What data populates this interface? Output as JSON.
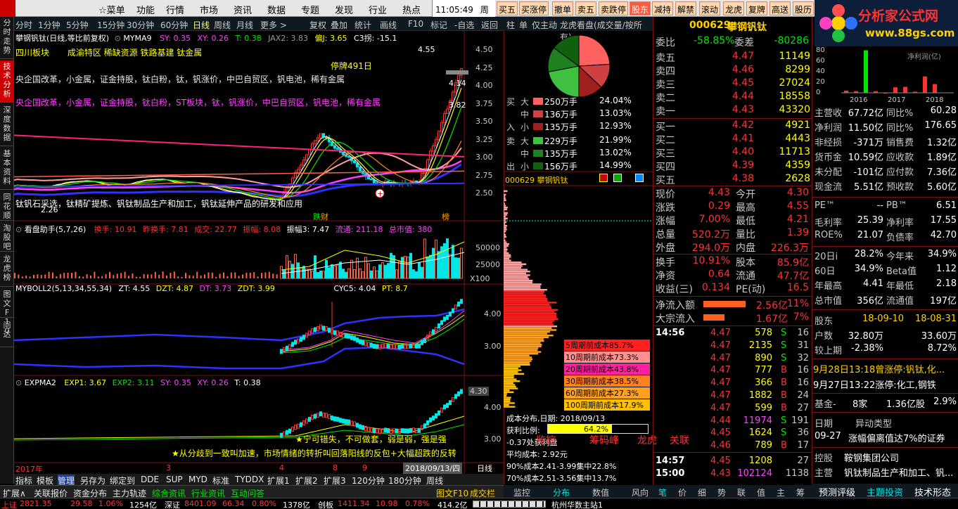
{
  "menu": {
    "items": [
      "☆菜单",
      "功能",
      "行情",
      "市场",
      "资讯",
      "数据",
      "专题",
      "发现",
      "行业",
      "热点"
    ],
    "time": "11:05:49",
    "weekday": "周五",
    "quick": [
      {
        "label": "买五",
        "red": false
      },
      {
        "label": "买涨停",
        "red": false
      },
      {
        "label": "撤单",
        "red": false
      },
      {
        "label": "卖五",
        "red": false
      },
      {
        "label": "卖跌停",
        "red": false
      },
      {
        "label": "股东",
        "red": true
      },
      {
        "label": "减持",
        "red": false
      },
      {
        "label": "解禁",
        "red": false
      },
      {
        "label": "滚动",
        "red": false
      },
      {
        "label": "龙虎",
        "red": false
      },
      {
        "label": "复牌",
        "red": false
      },
      {
        "label": "高送",
        "red": false
      },
      {
        "label": "股历",
        "red": false
      }
    ],
    "brand_title": "分析家公式网",
    "brand_url": "www.88gs.com"
  },
  "toolbar": {
    "left": [
      "分时",
      "1分钟",
      "5分钟",
      "15分钟",
      "30分钟",
      "60分钟",
      "日线",
      "周线",
      "月线",
      "更多 >"
    ],
    "right": [
      "复权",
      "叠加",
      "统计",
      "画线",
      "F10",
      "标记",
      "-自选",
      "返回"
    ],
    "active": "日线"
  },
  "vtabs": [
    "分时走势",
    "技术分析",
    "深度数据",
    "基本资料",
    "同花顺",
    "淘股吧",
    "龙虎榜",
    "图文F10",
    "问达"
  ],
  "main_panel": {
    "title": "攀钢钒钛(日线,等比前复权)",
    "ma_name": "MYMA9",
    "sy": "SY: 0.35",
    "xy": "XY: 0.26",
    "t": "T: 0.38",
    "jax": "JAX2: 3.83",
    "pj": "偏J: 3.65",
    "c3": "C3拐: -15.1",
    "sector": "四川板块",
    "themes": "成渝特区 稀缺资源 铁路基建 钛金属",
    "concept1": "央企国改革，小金属，证金持股，钛白粉，钛，钒涨价，中巴自贸区，钒电池，稀有金属",
    "concept2": "央企国改革，小金属，证金持股，钛白粉，ST板块，钛，钒涨价，中巴自贸区，钒电池，稀有金属",
    "suspend": "停牌491日",
    "high_label": "4.55",
    "last_label": "4.14",
    "mid_label": "3.82",
    "low_label": "2.26",
    "note": "钛钒石采选，钛精矿提炼、钒钛制品生产和加工，钒钛延伸产品的研发和应用",
    "tag_fall": "跌",
    "tag_fall2": "财",
    "tag_bang": "榜",
    "ticks": [
      "4.50",
      "4.25",
      "4.00",
      "3.75",
      "3.50",
      "3.25",
      "3.00",
      "2.75",
      "2.50"
    ]
  },
  "vol_panel": {
    "title": "看盘助手(5,7,26)",
    "hs": "换手: 10.91",
    "zhs": "昨换手: 7.81",
    "cj": "成交: 22.77",
    "zf": "振幅: 8.08",
    "zf3": "振幅3: 7.47",
    "lt": "流通: 211.18",
    "zsz": "总市值: 380",
    "ticks": [
      "50000",
      "25000",
      "X100"
    ]
  },
  "boll_panel": {
    "title": "MYBOLL2(5,13,34,55,34)",
    "zt": "ZT: 4.55",
    "dzt": "DZT: 4.87",
    "dt": "DT: 3.73",
    "zdt": "ZDT: 3.99",
    "cyc": "CYC5: 4.04",
    "pt": "PT: 8.7",
    "ticks": [
      "4.00",
      "3.00"
    ]
  },
  "expma_panel": {
    "title": "EXPMA2",
    "exp1": "EXP1: 3.67",
    "exp2": "EXP2: 3.11",
    "sy": "SY: 0.35",
    "xy": "XY: 0.26",
    "t": "T: 0.38",
    "ticks": [
      "4.30",
      "4.00",
      "3.00"
    ],
    "msg1": "宁可错失，不可做套，弱是弱，强是强",
    "msg2": "从分歧到一致叫加速，市场情绪的转折叫回落阳线的反包+大幅超跌的反转"
  },
  "time_axis": {
    "year": "2017年",
    "marks": [
      "3",
      "4",
      "8",
      "9"
    ],
    "date": "2018/09/13/四",
    "period": "日线",
    "plus": "+",
    "minus": "-"
  },
  "chart_tabs": [
    "指标",
    "模板",
    "管理",
    "另存为",
    "绑定到",
    "DDE",
    "SUP",
    "MYD",
    "标准",
    "TYDDX",
    "扩展1",
    "扩展2",
    "扩展3",
    "120分钟",
    "180分钟",
    "周线"
  ],
  "chart_tabs_active": "管理",
  "chart_tabs2": [
    "扩展∧",
    "关联报价",
    "资金分布",
    "主力轨迹",
    "综合资讯",
    "行业资讯",
    "互动问答"
  ],
  "chart_tabs2_right": [
    "图文F10",
    "成交栏"
  ],
  "mid_panel": {
    "head": [
      "柱",
      "单",
      "仅主动",
      "龙虎看盘(成交量/按所有)"
    ],
    "buy_rows": [
      {
        "side": "买",
        "size": "大",
        "amt": "250万手",
        "pct": "24.04%",
        "color": "#ff6060"
      },
      {
        "side": "",
        "size": "中",
        "amt": "136万手",
        "pct": "13.03%",
        "color": "#d04040"
      },
      {
        "side": "入",
        "size": "小",
        "amt": "135万手",
        "pct": "12.93%",
        "color": "#a02020"
      }
    ],
    "sell_rows": [
      {
        "side": "卖",
        "size": "大",
        "amt": "229万手",
        "pct": "21.99%",
        "color": "#40c040"
      },
      {
        "side": "",
        "size": "中",
        "amt": "135万手",
        "pct": "13.02%",
        "color": "#208020"
      },
      {
        "side": "出",
        "size": "小",
        "amt": "156万手",
        "pct": "14.99%",
        "color": "#106010"
      }
    ],
    "stock": "000629 攀钢钒钛",
    "cost_rows": [
      {
        "label": "5周期前成本85.7%",
        "bg": "#ff2020"
      },
      {
        "label": "10周期前成本73.3%",
        "bg": "#ff9090"
      },
      {
        "label": "20周期前成本43.8%",
        "bg": "#ff20a0"
      },
      {
        "label": "30周期前成本38.5%",
        "bg": "#ff8020"
      },
      {
        "label": "60周期前成本27.3%",
        "bg": "#ffa020"
      },
      {
        "label": "100周期前成本17.9%",
        "bg": "#ffc000"
      }
    ],
    "dist_date": "成本分布,日期: 2018/09/13",
    "profit_label": "获利比例:",
    "profit_pct": "64.2%",
    "profit_ratio": 0.642,
    "profit_line": "-0.37处获利盘",
    "avg_cost": "平均成本: 2.92元",
    "cost90": "90%成本2.41-3.99集中22.8%",
    "cost70": "70%成本2.51-3.56集中13.7%",
    "overlay": [
      "监控",
      "筹码峰",
      "龙虎",
      "关联"
    ],
    "bottom_tabs": [
      "监控",
      "分布",
      "数值",
      "风向"
    ]
  },
  "quote": {
    "code": "000629",
    "name": "攀钢钒钛",
    "wb_label": "委比",
    "wb": "-58.85%",
    "wc_label": "委差",
    "wc": "-80286",
    "sells": [
      {
        "label": "卖五",
        "price": "4.47",
        "vol": "11149"
      },
      {
        "label": "卖四",
        "price": "4.46",
        "vol": "8299"
      },
      {
        "label": "卖三",
        "price": "4.45",
        "vol": "27024"
      },
      {
        "label": "卖二",
        "price": "4.44",
        "vol": "18558"
      },
      {
        "label": "卖一",
        "price": "4.43",
        "vol": "43320"
      }
    ],
    "buys": [
      {
        "label": "买一",
        "price": "4.42",
        "vol": "4921"
      },
      {
        "label": "买二",
        "price": "4.41",
        "vol": "4443"
      },
      {
        "label": "买三",
        "price": "4.40",
        "vol": "11713"
      },
      {
        "label": "买四",
        "price": "4.39",
        "vol": "4359"
      },
      {
        "label": "买五",
        "price": "4.38",
        "vol": "2628"
      }
    ],
    "stats": [
      {
        "l1": "现价",
        "v1": "4.43",
        "l2": "今开",
        "v2": "4.30"
      },
      {
        "l1": "涨跌",
        "v1": "0.29",
        "l2": "最高",
        "v2": "4.55"
      },
      {
        "l1": "涨幅",
        "v1": "7.00%",
        "l2": "最低",
        "v2": "4.21"
      },
      {
        "l1": "总量",
        "v1": "520.2万",
        "l2": "量比",
        "v2": "1.39"
      },
      {
        "l1": "外盘",
        "v1": "294.0万",
        "l2": "内盘",
        "v2": "226.3万"
      }
    ],
    "stats2": [
      {
        "l1": "换手",
        "v1": "10.91%",
        "l2": "股本",
        "v2": "85.9亿"
      },
      {
        "l1": "净资",
        "v1": "0.64",
        "l2": "流通",
        "v2": "47.7亿"
      },
      {
        "l1": "收益(三)",
        "v1": "0.134",
        "l2": "PE(动)",
        "v2": "16.5"
      }
    ],
    "flows": [
      {
        "label": "净流入额",
        "val": "2.56亿",
        "pct": "11%"
      },
      {
        "label": "大宗流入",
        "val": "1.67亿",
        "pct": "7%"
      }
    ],
    "ticks": [
      {
        "time": "14:56",
        "price": "4.47",
        "vol": "578",
        "bs": "S",
        "n": "16"
      },
      {
        "time": "",
        "price": "4.47",
        "vol": "2135",
        "bs": "S",
        "n": "31"
      },
      {
        "time": "",
        "price": "4.47",
        "vol": "890",
        "bs": "S",
        "n": "32"
      },
      {
        "time": "",
        "price": "4.47",
        "vol": "777",
        "bs": "B",
        "n": "16"
      },
      {
        "time": "",
        "price": "4.47",
        "vol": "366",
        "bs": "B",
        "n": "16"
      },
      {
        "time": "",
        "price": "4.47",
        "vol": "1882",
        "bs": "B",
        "n": "24"
      },
      {
        "time": "",
        "price": "4.47",
        "vol": "599",
        "bs": "B",
        "n": "27"
      },
      {
        "time": "",
        "price": "4.44",
        "vol": "11974",
        "bs": "S",
        "n": "191"
      },
      {
        "time": "",
        "price": "4.45",
        "vol": "1624",
        "bs": "S",
        "n": "36"
      },
      {
        "time": "",
        "price": "4.46",
        "vol": "789",
        "bs": "B",
        "n": "17"
      },
      {
        "time": "14:57",
        "price": "4.45",
        "vol": "1208",
        "bs": "",
        "n": "27"
      },
      {
        "time": "15:00",
        "price": "4.43",
        "vol": "102124",
        "bs": "",
        "n": "1138"
      }
    ],
    "bottom_tabs": [
      "笔",
      "价",
      "细",
      "势",
      "联",
      "值",
      "主",
      "筹"
    ]
  },
  "fund": {
    "chart_years": [
      "2016",
      "2017",
      "2018"
    ],
    "chart_yticks": [
      "80",
      "60",
      "40",
      "20",
      "0"
    ],
    "chart_note": "净利润(亿)",
    "chart_values": [
      4,
      3,
      78,
      3,
      0,
      10,
      11,
      2,
      30,
      16
    ],
    "rows": [
      {
        "l1": "主营收",
        "v1": "67.72亿",
        "l2": "同比%",
        "v2": "60.28"
      },
      {
        "l1": "净利润",
        "v1": "11.50亿",
        "l2": "同比%",
        "v2": "176.65"
      },
      {
        "l1": "非经损",
        "v1": "-371万",
        "l2": "销售费",
        "v2": "1.32亿"
      },
      {
        "l1": "货币金",
        "v1": "10.59亿",
        "l2": "应收款",
        "v2": "1.89亿"
      },
      {
        "l1": "未分配",
        "v1": "-101亿",
        "l2": "应付款",
        "v2": "7.36亿"
      },
      {
        "l1": "现金流",
        "v1": "5.51亿",
        "l2": "预收款",
        "v2": "5.60亿"
      }
    ],
    "pe_label": "PE™",
    "pe_val": "--",
    "pb_label": "PB™",
    "pb_val": "6.51",
    "rows2": [
      {
        "l1": "毛利率",
        "v1": "25.39",
        "l2": "净利率",
        "v2": "17.55"
      },
      {
        "l1": "ROE%",
        "v1": "21.07",
        "l2": "负债率",
        "v2": "42.70"
      }
    ],
    "rows3": [
      {
        "l1": "20日i",
        "v1": "28.2%",
        "l2": "今年来",
        "v2": "34.9%"
      },
      {
        "l1": "60日",
        "v1": "34.9%",
        "l2": "Beta值",
        "v2": "1.12"
      },
      {
        "l1": "年最高",
        "v1": "4.41",
        "l2": "年最低",
        "v2": "2.18"
      },
      {
        "l1": "总市值",
        "v1": "356亿",
        "l2": "流通值",
        "v2": "197亿"
      }
    ],
    "holder_label": "股东",
    "holder_d1": "18-09-10",
    "holder_d2": "18-08-31",
    "hu_label": "户数",
    "hu_v1": "32.80万",
    "hu_v2": "33.60万",
    "jsq_label": "较上期",
    "jsq_v1": "-2.38%",
    "jsq_v2": "8.72%",
    "news1": "9月28日13:18曾涨停:钒钛,化...",
    "news2": "9月27日13:22涨停:化工,钢铁",
    "fund_label": "基金-",
    "fund_cnt": "8家",
    "fund_amt": "1.36亿股",
    "fund_pct": "2.9%",
    "date_label": "日期",
    "type_label": "异动类型",
    "ev_date": "09-27",
    "ev_type": "涨幅偏离值达7%的证券",
    "ctrl_label": "控股",
    "ctrl_val": "鞍钢集团公司",
    "main_label": "主营",
    "main_val": "钒钛制品生产和加工、钒...",
    "bottom": [
      "预测评级",
      "主题投资",
      "技术形态"
    ]
  },
  "status": {
    "sh_label": "上证",
    "sh_val": "2821.35",
    "sh_chg": "29.58",
    "sh_pct": "1.06%",
    "sh_amt": "1254亿",
    "sz_label": "深证",
    "sz_val": "8401.09",
    "sz_chg": "66.34",
    "sz_pct": "0.80%",
    "sz_amt": "1378亿",
    "cy_label": "创板",
    "cy_val": "1411.34",
    "cy_chg": "10.98",
    "cy_pct": "0.78%",
    "cy_amt": "414.2亿",
    "site": "杭州华数主站1"
  },
  "colors": {
    "up": "#ff3232",
    "down": "#00e600",
    "ma_yellow": "#ffff00",
    "ma_magenta": "#ff40ff",
    "ma_blue": "#3030ff",
    "ma_pink": "#ffa0a0"
  }
}
